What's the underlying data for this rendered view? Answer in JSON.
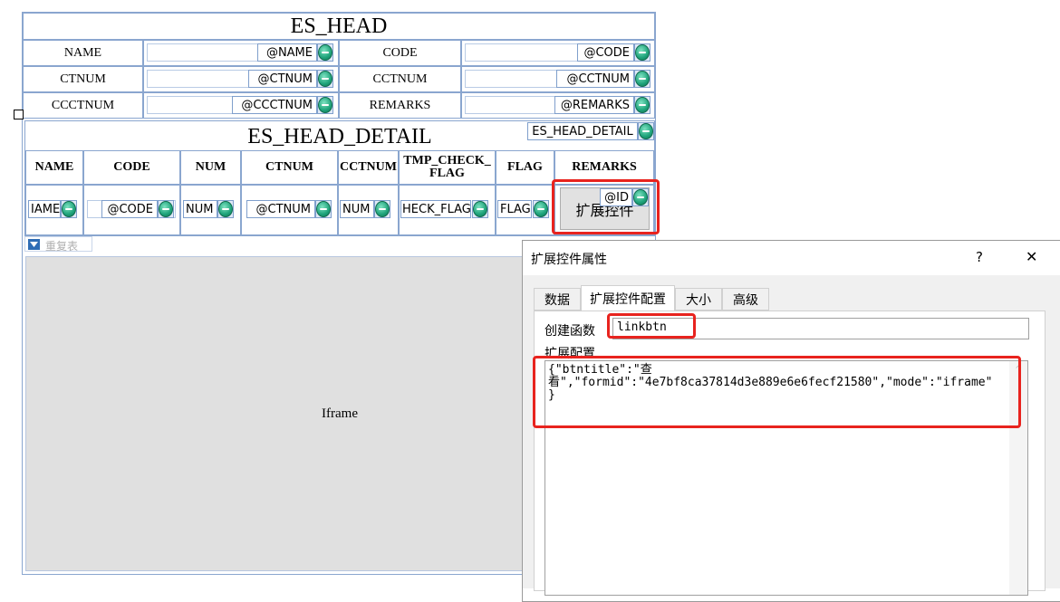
{
  "form": {
    "title": "ES_HEAD",
    "fields": [
      {
        "label": "NAME",
        "tag": "@NAME"
      },
      {
        "label": "CODE",
        "tag": "@CODE"
      },
      {
        "label": "CTNUM",
        "tag": "@CTNUM"
      },
      {
        "label": "CCTNUM",
        "tag": "@CCTNUM"
      },
      {
        "label": "CCCTNUM",
        "tag": "@CCCTNUM"
      },
      {
        "label": "REMARKS",
        "tag": "@REMARKS"
      }
    ]
  },
  "detail": {
    "title": "ES_HEAD_DETAIL",
    "tag": "ES_HEAD_DETAIL",
    "columns": [
      "NAME",
      "CODE",
      "NUM",
      "CTNUM",
      "CCTNUM",
      "TMP_CHECK_\nFLAG",
      "FLAG",
      "REMARKS"
    ],
    "cells": [
      "IAME",
      "@CODE",
      "NUM",
      "@CTNUM",
      "NUM",
      "HECK_FLAG",
      "FLAG",
      "扩展控件"
    ],
    "id_tag": "@ID",
    "repeat_label": "重复表"
  },
  "iframe": {
    "label": "Iframe"
  },
  "dialog": {
    "title": "扩展控件属性",
    "help": "?",
    "close": "✕",
    "tabs": [
      "数据",
      "扩展控件配置",
      "大小",
      "高级"
    ],
    "active_tab": 1,
    "create_fn_label": "创建函数",
    "create_fn_value": "linkbtn",
    "config_label": "扩展配置",
    "config_value": "{\"btntitle\":\"查\n看\",\"formid\":\"4e7bf8ca37814d3e889e6e6fecf21580\",\"mode\":\"iframe\"\n}"
  },
  "colors": {
    "border": "#8aa6cf",
    "accent": "#e8231e",
    "icon_green": "#1ea37a",
    "iframe_bg": "#e0e0e0"
  }
}
